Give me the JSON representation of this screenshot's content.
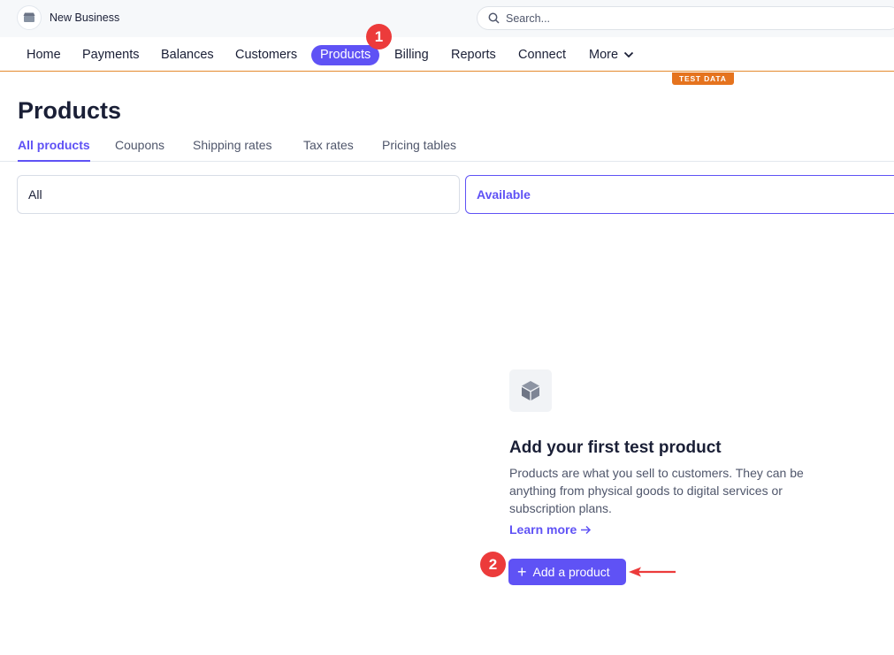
{
  "topbar": {
    "business_name": "New Business",
    "search_placeholder": "Search..."
  },
  "nav": {
    "items": [
      "Home",
      "Payments",
      "Balances",
      "Customers",
      "Products",
      "Billing",
      "Reports",
      "Connect",
      "More"
    ],
    "active": "Products"
  },
  "annotations": {
    "step1": "1",
    "step2": "2"
  },
  "test_data_label": "TEST DATA",
  "page": {
    "title": "Products",
    "tabs": [
      "All products",
      "Coupons",
      "Shipping rates",
      "Tax rates",
      "Pricing tables"
    ],
    "active_tab": "All products"
  },
  "filters": {
    "all": "All",
    "available": "Available"
  },
  "empty_state": {
    "title": "Add your first test product",
    "description": "Products are what you sell to customers. They can be anything from physical goods to digital services or subscription plans.",
    "learn_more": "Learn more",
    "button_label": "Add a product"
  },
  "colors": {
    "accent": "#5f52f5",
    "test_badge": "#e5731e",
    "annotation_red": "#ec3b3b"
  },
  "icons": [
    "store-icon",
    "search-icon",
    "chevron-down-icon",
    "box-icon",
    "arrow-right-icon",
    "plus-icon",
    "annotation-arrow-icon"
  ]
}
